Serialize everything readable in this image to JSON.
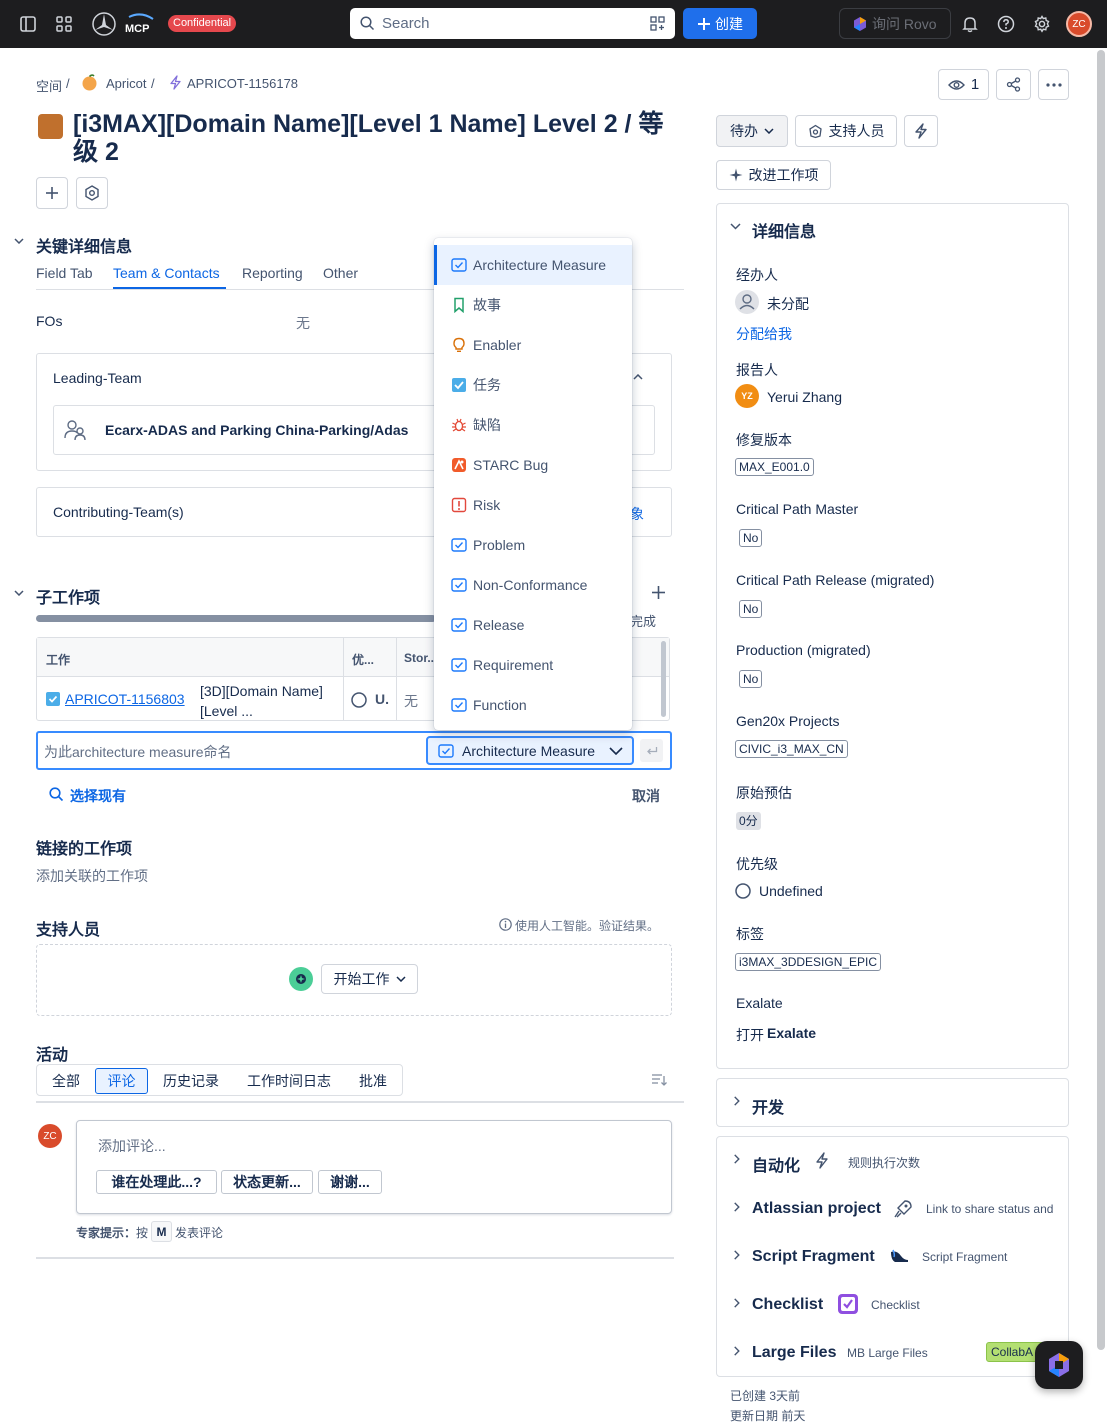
{
  "nav": {
    "badge": "Confidential",
    "search_placeholder": "Search",
    "create_label": "创建",
    "rovo_label": "询问 Rovo",
    "avatar_initials": "ZC"
  },
  "breadcrumb": {
    "space": "空间",
    "sep1": "/",
    "project": "Apricot",
    "sep2": "/",
    "issue_key": "APRICOT-1156178"
  },
  "header_actions": {
    "watchers": "1"
  },
  "issue": {
    "title": "[i3MAX][Domain Name][Level 1 Name] Level 2 / 等级 2"
  },
  "status_bar": {
    "status": "待办",
    "support": "支持人员",
    "improve": "改进工作项"
  },
  "key_details": {
    "title": "关键详细信息",
    "tabs": [
      "Field Tab",
      "Team & Contacts",
      "Reporting",
      "Other"
    ],
    "fos_label": "FOs",
    "fos_value": "无",
    "leading_team_label": "Leading-Team",
    "leading_team_value": "Ecarx-ADAS and Parking China-Parking/Adas",
    "contributing_label": "Contributing-Team(s)",
    "contributing_partial": "象"
  },
  "dropdown": {
    "items": [
      {
        "label": "Architecture Measure",
        "icon": "checkbox-icon",
        "color": "#1d7afc"
      },
      {
        "label": "故事",
        "icon": "bookmark-icon",
        "color": "#22a06b"
      },
      {
        "label": "Enabler",
        "icon": "bulb-icon",
        "color": "#d97008"
      },
      {
        "label": "任务",
        "icon": "task-icon",
        "color": "#4bade8"
      },
      {
        "label": "缺陷",
        "icon": "bug-icon",
        "color": "#e34935"
      },
      {
        "label": "STARC Bug",
        "icon": "starc-icon",
        "color": "#f15b2a"
      },
      {
        "label": "Risk",
        "icon": "risk-icon",
        "color": "#e2483d"
      },
      {
        "label": "Problem",
        "icon": "checkbox-icon",
        "color": "#1d7afc"
      },
      {
        "label": "Non-Conformance",
        "icon": "checkbox-icon",
        "color": "#1d7afc"
      },
      {
        "label": "Release",
        "icon": "checkbox-icon",
        "color": "#1d7afc"
      },
      {
        "label": "Requirement",
        "icon": "checkbox-icon",
        "color": "#1d7afc"
      },
      {
        "label": "Function",
        "icon": "checkbox-icon",
        "color": "#1d7afc"
      }
    ]
  },
  "subtasks": {
    "title": "子工作项",
    "done_partial": "完成",
    "col_work": "工作",
    "col_priority": "优...",
    "col_story": "Stor...",
    "row_key": "APRICOT-1156803",
    "row_summary": "[3D][Domain Name][Level ...",
    "row_priority": "U.",
    "row_story": "无",
    "input_placeholder": "为此architecture measure命名",
    "type_select": "Architecture Measure",
    "choose_existing": "选择现有",
    "cancel": "取消"
  },
  "linked": {
    "title": "链接的工作项",
    "add": "添加关联的工作项"
  },
  "support": {
    "title": "支持人员",
    "ai_note": "使用人工智能。验证结果。",
    "start_work": "开始工作"
  },
  "activity": {
    "title": "活动",
    "tabs": [
      "全部",
      "评论",
      "历史记录",
      "工作时间日志",
      "批准"
    ],
    "avatar": "ZC",
    "comment_placeholder": "添加评论...",
    "quick_replies": [
      "谁在处理此...?",
      "状态更新...",
      "谢谢..."
    ],
    "tip_prefix": "专家提示：",
    "tip_mid": "按",
    "tip_key": "M",
    "tip_suffix": "发表评论"
  },
  "details": {
    "title": "详细信息",
    "assignee_label": "经办人",
    "assignee_value": "未分配",
    "assign_me": "分配给我",
    "reporter_label": "报告人",
    "reporter_initials": "YZ",
    "reporter_value": "Yerui Zhang",
    "fix_version_label": "修复版本",
    "fix_version_value": "MAX_E001.0",
    "cpm_label": "Critical Path Master",
    "cpm_value": "No",
    "cpr_label": "Critical Path Release (migrated)",
    "cpr_value": "No",
    "prod_label": "Production (migrated)",
    "prod_value": "No",
    "gen_label": "Gen20x Projects",
    "gen_value": "CIVIC_i3_MAX_CN",
    "estimate_label": "原始预估",
    "estimate_value": "0分",
    "priority_label": "优先级",
    "priority_value": "Undefined",
    "labels_label": "标签",
    "labels_value": "i3MAX_3DDESIGN_EPIC",
    "exalate_label": "Exalate",
    "exalate_open": "打开",
    "exalate_name": "Exalate"
  },
  "panels": {
    "dev": "开发",
    "automation": "自动化",
    "automation_sub": "规则执行次数",
    "atlassian": "Atlassian project",
    "atlassian_sub": "Link to share status and",
    "script": "Script Fragment",
    "script_sub": "Script Fragment",
    "checklist": "Checklist",
    "checklist_sub": "Checklist",
    "large": "Large Files",
    "large_sub": "MB Large Files",
    "collab": "CollabA"
  },
  "footer": {
    "created": "已创建 3天前",
    "updated": "更新日期 前天"
  }
}
